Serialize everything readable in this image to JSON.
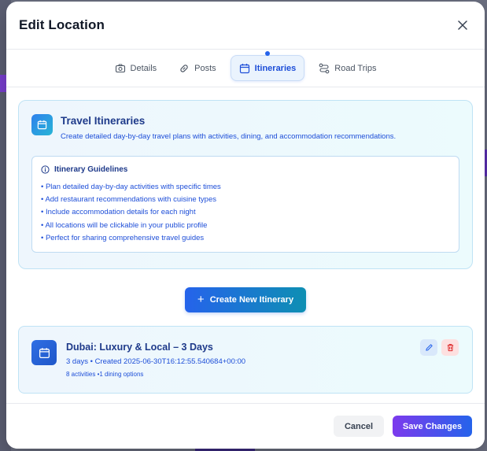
{
  "modal": {
    "title": "Edit Location",
    "close_icon": "close-icon"
  },
  "tabs": [
    {
      "label": "Details",
      "icon": "camera-icon",
      "active": false
    },
    {
      "label": "Posts",
      "icon": "link-icon",
      "active": false
    },
    {
      "label": "Itineraries",
      "icon": "calendar-icon",
      "active": true
    },
    {
      "label": "Road Trips",
      "icon": "route-icon",
      "active": false
    }
  ],
  "info": {
    "title": "Travel Itineraries",
    "description": "Create detailed day-by-day travel plans with activities, dining, and accommodation recommendations.",
    "guidelines_title": "Itinerary Guidelines",
    "guidelines": [
      "• Plan detailed day-by-day activities with specific times",
      "• Add restaurant recommendations with cuisine types",
      "• Include accommodation details for each night",
      "• All locations will be clickable in your public profile",
      "• Perfect for sharing comprehensive travel guides"
    ]
  },
  "create_button": {
    "icon": "+",
    "label": "Create New Itinerary"
  },
  "itinerary": {
    "title": "Dubai: Luxury & Local – 3 Days",
    "meta": "3 days • Created 2025-06-30T16:12:55.540684+00:00",
    "sub": "8 activities •1 dining options"
  },
  "footer": {
    "cancel_label": "Cancel",
    "save_label": "Save Changes"
  },
  "colors": {
    "accent": "#2563eb",
    "save_gradient_start": "#7c3aed",
    "delete": "#dc2626"
  }
}
